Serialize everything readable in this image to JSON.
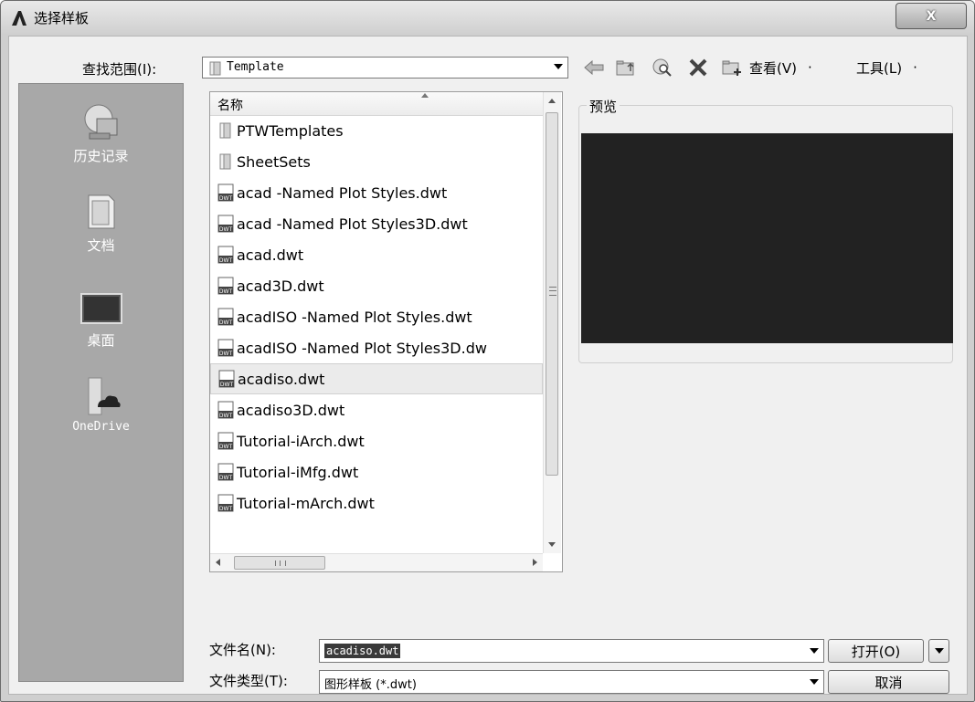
{
  "window": {
    "title": "选择样板",
    "close_label": "X"
  },
  "lookin": {
    "label": "查找范围(I):",
    "value": "Template"
  },
  "toolbar": {
    "view_label": "查看(V)",
    "tools_label": "工具(L)",
    "dot": "·"
  },
  "list": {
    "column_name": "名称",
    "items": [
      {
        "name": "PTWTemplates",
        "type": "folder"
      },
      {
        "name": "SheetSets",
        "type": "folder"
      },
      {
        "name": "acad -Named Plot Styles.dwt",
        "type": "dwt"
      },
      {
        "name": "acad -Named Plot Styles3D.dwt",
        "type": "dwt"
      },
      {
        "name": "acad.dwt",
        "type": "dwt"
      },
      {
        "name": "acad3D.dwt",
        "type": "dwt"
      },
      {
        "name": "acadISO -Named Plot Styles.dwt",
        "type": "dwt"
      },
      {
        "name": "acadISO -Named Plot Styles3D.dw",
        "type": "dwt"
      },
      {
        "name": "acadiso.dwt",
        "type": "dwt",
        "selected": true
      },
      {
        "name": "acadiso3D.dwt",
        "type": "dwt"
      },
      {
        "name": "Tutorial-iArch.dwt",
        "type": "dwt"
      },
      {
        "name": "Tutorial-iMfg.dwt",
        "type": "dwt"
      },
      {
        "name": "Tutorial-mArch.dwt",
        "type": "dwt"
      }
    ]
  },
  "places": {
    "history": "历史记录",
    "documents": "文档",
    "desktop": "桌面",
    "onedrive": "OneDrive"
  },
  "preview": {
    "label": "预览"
  },
  "filename": {
    "label": "文件名(N):",
    "value": "acadiso.dwt"
  },
  "filetype": {
    "label": "文件类型(T):",
    "value": "图形样板 (*.dwt)"
  },
  "buttons": {
    "open": "打开(O)",
    "cancel": "取消"
  },
  "colors": {
    "preview_bg": "#222222",
    "places_bg": "#a8a8a8"
  }
}
